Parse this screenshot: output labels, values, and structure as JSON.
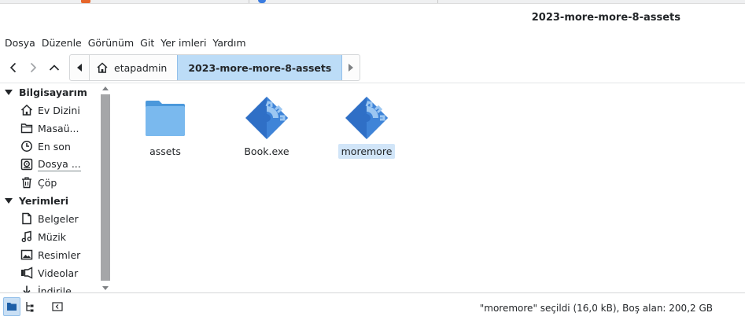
{
  "window": {
    "title": "2023-more-more-8-assets"
  },
  "menu": [
    "Dosya",
    "Düzenle",
    "Görünüm",
    "Git",
    "Yer imleri",
    "Yardım"
  ],
  "breadcrumb": {
    "home_label": "etapadmin",
    "current_label": "2023-more-more-8-assets"
  },
  "sidebar": {
    "sections": [
      {
        "header": "Bilgisayarım",
        "items": [
          {
            "label": "Ev Dizini",
            "icon": "home-icon"
          },
          {
            "label": "Masaü...",
            "icon": "folder-icon"
          },
          {
            "label": "En son",
            "icon": "clock-icon"
          },
          {
            "label": "Dosya ...",
            "icon": "drive-icon"
          },
          {
            "label": "Çöp",
            "icon": "trash-icon"
          }
        ]
      },
      {
        "header": "Yerimleri",
        "items": [
          {
            "label": "Belgeler",
            "icon": "document-icon"
          },
          {
            "label": "Müzik",
            "icon": "music-icon"
          },
          {
            "label": "Resimler",
            "icon": "image-icon"
          },
          {
            "label": "Videolar",
            "icon": "video-icon"
          },
          {
            "label": "İndirile...",
            "icon": "download-icon"
          }
        ]
      }
    ]
  },
  "files": [
    {
      "name": "assets",
      "type": "folder",
      "selected": false
    },
    {
      "name": "Book.exe",
      "type": "executable",
      "selected": false
    },
    {
      "name": "moremore",
      "type": "executable",
      "selected": true
    }
  ],
  "status": {
    "text": "\"moremore\" seçildi (16,0 kB), Boş alan: 200,2 GB"
  },
  "colors": {
    "accent": "#3daee9",
    "selection": "#d1e5f8",
    "breadcrumb_active": "#bcdcf7",
    "folder": "#5ea8e5",
    "exe_icon": "#2f6fc6"
  }
}
